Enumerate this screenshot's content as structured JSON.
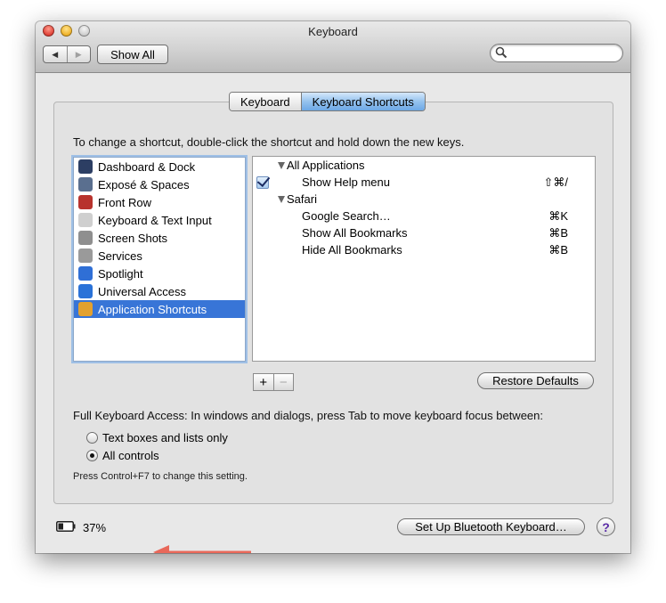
{
  "window": {
    "title": "Keyboard"
  },
  "toolbar": {
    "back_glyph": "◀",
    "forward_glyph": "▶",
    "show_all_label": "Show All",
    "search_value": "",
    "search_placeholder": ""
  },
  "tabs": [
    {
      "label": "Keyboard",
      "active": false
    },
    {
      "label": "Keyboard Shortcuts",
      "active": true
    }
  ],
  "instructions": "To change a shortcut, double-click the shortcut and hold down the new keys.",
  "categories": [
    {
      "label": "Dashboard & Dock",
      "icon": "dashboard-dock-icon",
      "color": "#2c3e63",
      "selected": false
    },
    {
      "label": "Exposé & Spaces",
      "icon": "expose-spaces-icon",
      "color": "#5a6f8f",
      "selected": false
    },
    {
      "label": "Front Row",
      "icon": "front-row-icon",
      "color": "#b8332d",
      "selected": false
    },
    {
      "label": "Keyboard & Text Input",
      "icon": "keyboard-text-input-icon",
      "color": "#cfcfcf",
      "selected": false
    },
    {
      "label": "Screen Shots",
      "icon": "screen-shots-icon",
      "color": "#8f8f8f",
      "selected": false
    },
    {
      "label": "Services",
      "icon": "services-icon",
      "color": "#9a9a9a",
      "selected": false
    },
    {
      "label": "Spotlight",
      "icon": "spotlight-icon",
      "color": "#2f6fd6",
      "selected": false
    },
    {
      "label": "Universal Access",
      "icon": "universal-access-icon",
      "color": "#2a72d8",
      "selected": false
    },
    {
      "label": "Application Shortcuts",
      "icon": "application-shortcuts-icon",
      "color": "#e3a12f",
      "selected": true
    }
  ],
  "shortcuts": [
    {
      "type": "group",
      "label": "All Applications"
    },
    {
      "type": "item",
      "label": "Show Help menu",
      "key": "⇧⌘/",
      "checked": true
    },
    {
      "type": "group",
      "label": "Safari"
    },
    {
      "type": "item",
      "label": "Google Search…",
      "key": "⌘K",
      "checked": false
    },
    {
      "type": "item",
      "label": "Show All Bookmarks",
      "key": "⌘B",
      "checked": false
    },
    {
      "type": "item",
      "label": "Hide All Bookmarks",
      "key": "⌘B",
      "checked": false
    }
  ],
  "list_controls": {
    "add": "+",
    "remove": "−"
  },
  "restore_defaults_label": "Restore Defaults",
  "full_keyboard_access": {
    "label": "Full Keyboard Access: In windows and dialogs, press Tab to move keyboard focus between:",
    "options": [
      {
        "label": "Text boxes and lists only",
        "selected": false
      },
      {
        "label": "All controls",
        "selected": true
      }
    ],
    "note": "Press Control+F7 to change this setting."
  },
  "footer": {
    "battery_percent": "37%",
    "battery_level": 0.37,
    "setup_bluetooth_label": "Set Up Bluetooth Keyboard…",
    "help_glyph": "?"
  },
  "annotation": {
    "arrow_color": "#e8685a"
  }
}
